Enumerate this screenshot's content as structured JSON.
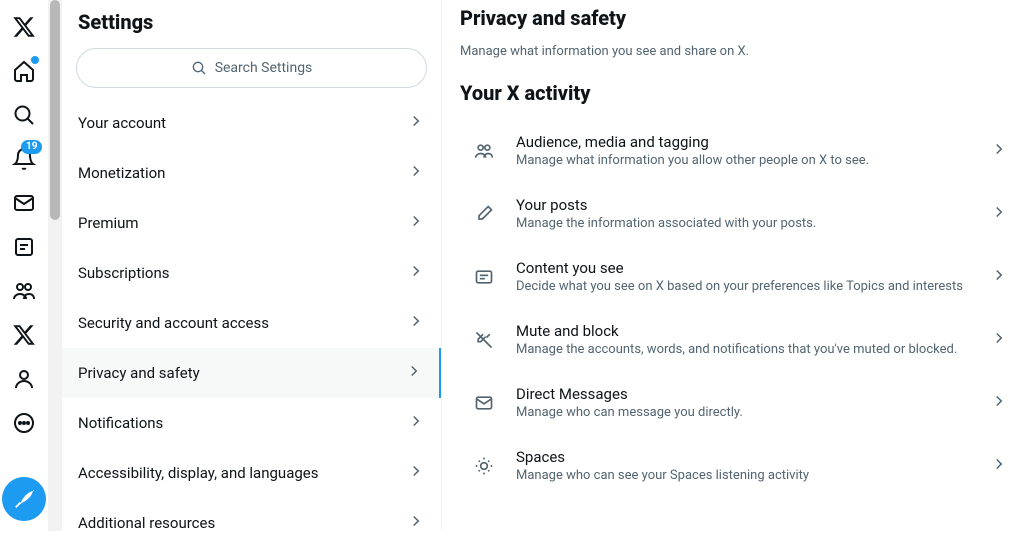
{
  "rail": {
    "home_dot": true,
    "notif_badge": "19"
  },
  "settings": {
    "title": "Settings",
    "search_placeholder": "Search Settings",
    "items": [
      {
        "label": "Your account"
      },
      {
        "label": "Monetization"
      },
      {
        "label": "Premium"
      },
      {
        "label": "Subscriptions"
      },
      {
        "label": "Security and account access"
      },
      {
        "label": "Privacy and safety",
        "active": true
      },
      {
        "label": "Notifications"
      },
      {
        "label": "Accessibility, display, and languages"
      },
      {
        "label": "Additional resources"
      }
    ]
  },
  "detail": {
    "title": "Privacy and safety",
    "subtitle": "Manage what information you see and share on X.",
    "section": "Your X activity",
    "activities": [
      {
        "title": "Audience, media and tagging",
        "desc": "Manage what information you allow other people on X to see."
      },
      {
        "title": "Your posts",
        "desc": "Manage the information associated with your posts."
      },
      {
        "title": "Content you see",
        "desc": "Decide what you see on X based on your preferences like Topics and interests"
      },
      {
        "title": "Mute and block",
        "desc": "Manage the accounts, words, and notifications that you've muted or blocked."
      },
      {
        "title": "Direct Messages",
        "desc": "Manage who can message you directly."
      },
      {
        "title": "Spaces",
        "desc": "Manage who can see your Spaces listening activity"
      }
    ]
  }
}
